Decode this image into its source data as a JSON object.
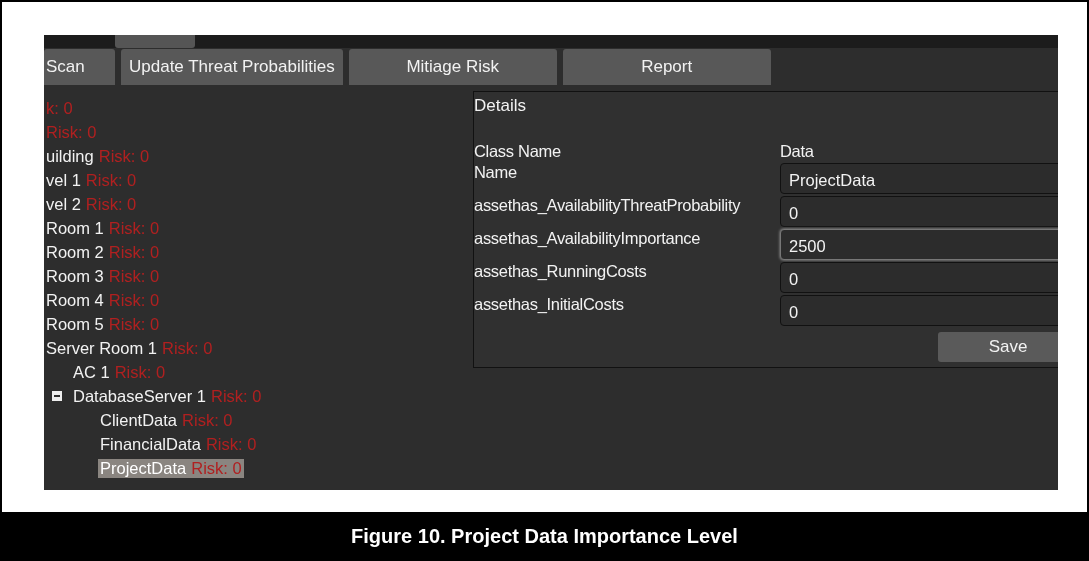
{
  "toolbar": {
    "buttons": [
      "Scan",
      "Update Threat Probabilities",
      "Mitiage Risk",
      "Report"
    ]
  },
  "tree": [
    {
      "risk": "k: 0",
      "selected": false
    },
    {
      "risk": "Risk: 0",
      "selected": false
    },
    {
      "name": "uilding",
      "risk": "Risk: 0",
      "selected": false
    },
    {
      "name": "vel 1",
      "risk": "Risk: 0",
      "selected": false
    },
    {
      "name": "vel 2",
      "risk": "Risk: 0",
      "selected": false
    },
    {
      "name": "Room 1",
      "risk": "Risk: 0",
      "selected": false
    },
    {
      "name": "Room 2",
      "risk": "Risk: 0",
      "selected": false
    },
    {
      "name": "Room 3",
      "risk": "Risk: 0",
      "selected": false
    },
    {
      "name": "Room 4",
      "risk": "Risk: 0",
      "selected": false
    },
    {
      "name": "Room 5",
      "risk": "Risk: 0",
      "selected": false
    },
    {
      "name": "Server Room 1",
      "risk": "Risk: 0",
      "selected": false,
      "children": [
        {
          "name": "AC 1",
          "risk": "Risk: 0",
          "selected": false
        },
        {
          "name": "DatabaseServer 1",
          "risk": "Risk: 0",
          "selected": false,
          "expanded": true,
          "children": [
            {
              "name": "ClientData",
              "risk": "Risk: 0",
              "selected": false
            },
            {
              "name": "FinancialData",
              "risk": "Risk: 0",
              "selected": false
            },
            {
              "name": "ProjectData",
              "risk": "Risk: 0",
              "selected": true
            }
          ]
        }
      ]
    }
  ],
  "details": {
    "title": "Details",
    "header": {
      "class_name": "Class Name",
      "data": "Data"
    },
    "fields": [
      {
        "label": "Name",
        "value": "ProjectData",
        "focused": false
      },
      {
        "label": "assethas_AvailabilityThreatProbability",
        "value": "0",
        "focused": false
      },
      {
        "label": "assethas_AvailabilityImportance",
        "value": "2500",
        "focused": true
      },
      {
        "label": "assethas_RunningCosts",
        "value": "0",
        "focused": false
      },
      {
        "label": "assethas_InitialCosts",
        "value": "0",
        "focused": false
      }
    ],
    "save_button": "Save"
  },
  "caption": "Figure 10. Project Data Importance Level"
}
